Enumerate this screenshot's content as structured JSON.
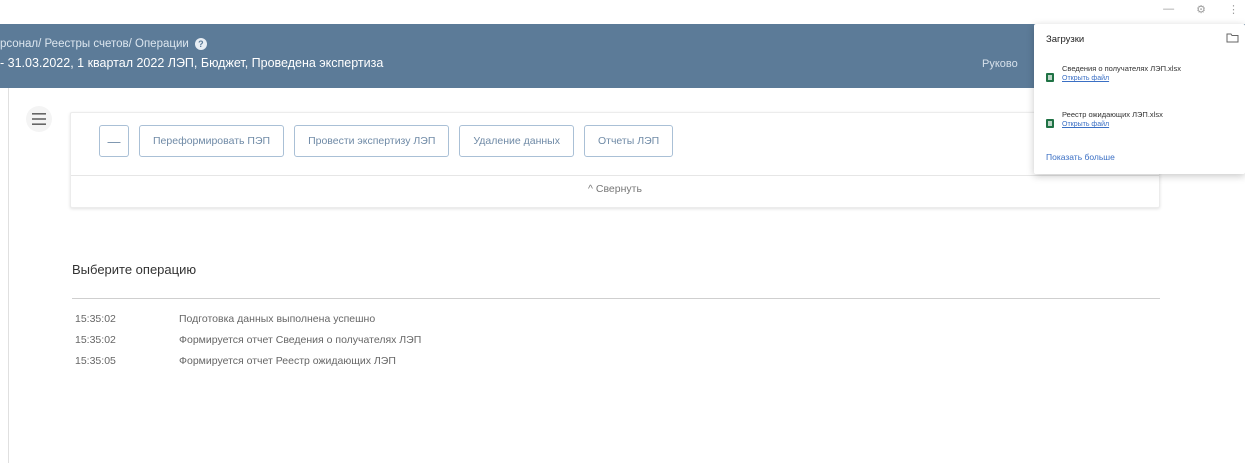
{
  "header": {
    "breadcrumbs": "рсонал/ Реестры счетов/ Операции",
    "subtitle": "- 31.03.2022, 1 квартал 2022 ЛЭП, Бюджет, Проведена экспертиза",
    "right_text": "Руково"
  },
  "toolbar": {
    "buttons": [
      {
        "label": "—"
      },
      {
        "label": "Переформировать ПЭП"
      },
      {
        "label": "Провести экспертизу ЛЭП"
      },
      {
        "label": "Удаление данных"
      },
      {
        "label": "Отчеты ЛЭП"
      }
    ],
    "collapse_label": "^ Свернуть"
  },
  "operations": {
    "title": "Выберите операцию",
    "log": [
      {
        "time": "15:35:02",
        "message": "Подготовка данных выполнена успешно"
      },
      {
        "time": "15:35:02",
        "message": "Формируется отчет Сведения о получателях ЛЭП"
      },
      {
        "time": "15:35:05",
        "message": "Формируется отчет Реестр ожидающих ЛЭП"
      }
    ]
  },
  "downloads": {
    "title": "Загрузки",
    "items": [
      {
        "name": "Сведения о получателях ЛЭП.xlsx",
        "link": "Открыть файл",
        "icon": "excel-file-icon"
      },
      {
        "name": "Реестр ожидающих ЛЭП.xlsx",
        "link": "Открыть файл",
        "icon": "excel-file-icon"
      }
    ],
    "show_more": "Показать больше"
  },
  "colors": {
    "header_bg": "#5c7b98",
    "button_border": "#aac0d6",
    "link": "#3a6fc4"
  }
}
